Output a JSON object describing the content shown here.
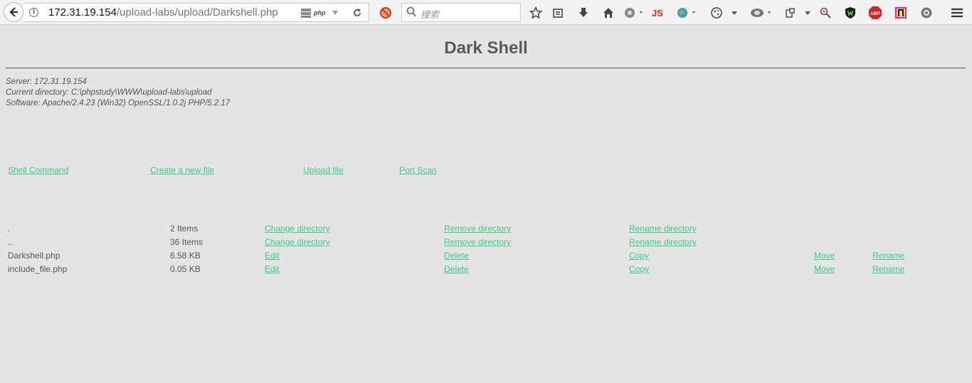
{
  "browser": {
    "url_host": "172.31.19.154",
    "url_path": "/upload-labs/upload/Darkshell.php",
    "php_badge": "php",
    "search_placeholder": "搜索",
    "js_label": "JS",
    "abp_label": "ABP",
    "icons": [
      "back-arrow-icon",
      "info-icon",
      "server-icon",
      "reload-icon",
      "ad-block-icon",
      "search-icon",
      "star-icon",
      "reading-list-icon",
      "download-icon",
      "home-icon",
      "web-developer-icon",
      "js-icon",
      "globe-icon",
      "cookie-icon",
      "hackbar-icon",
      "screenshot-icon",
      "key-icon",
      "shield-icon",
      "abp-icon",
      "pocket-icon",
      "settings-icon",
      "menu-icon"
    ]
  },
  "page": {
    "title": "Dark Shell",
    "server_line": "Server: 172.31.19.154",
    "directory_line": "Current directory: C:\\phpstudy\\WWW\\upload-labs\\upload",
    "software_line": "Software: Apache/2.4.23 (Win32) OpenSSL/1.0.2j PHP/5.2.17"
  },
  "nav": {
    "shell_command": "Shell Command",
    "create_file": "Create a new file",
    "upload_file": "Upload file",
    "port_scan": "Port Scan"
  },
  "files": [
    {
      "name": ".",
      "size": "2 Items",
      "a1": "Change directory",
      "a2": "Remove directory",
      "a3": "Rename directory"
    },
    {
      "name": "..",
      "size": "36 Items",
      "a1": "Change directory",
      "a2": "Remove directory",
      "a3": "Rename directory"
    },
    {
      "name": "Darkshell.php",
      "size": "6.58 KB",
      "a1": "Edit",
      "a2": "Delete",
      "a3": "Copy",
      "a4": "Move",
      "a5": "Rename"
    },
    {
      "name": "include_file.php",
      "size": "0.05 KB",
      "a1": "Edit",
      "a2": "Delete",
      "a3": "Copy",
      "a4": "Move",
      "a5": "Rename"
    }
  ],
  "colors": {
    "link": "#3ec787",
    "background": "#e4e4e4",
    "js": "#d52a2a",
    "abp": "#d8232a"
  }
}
